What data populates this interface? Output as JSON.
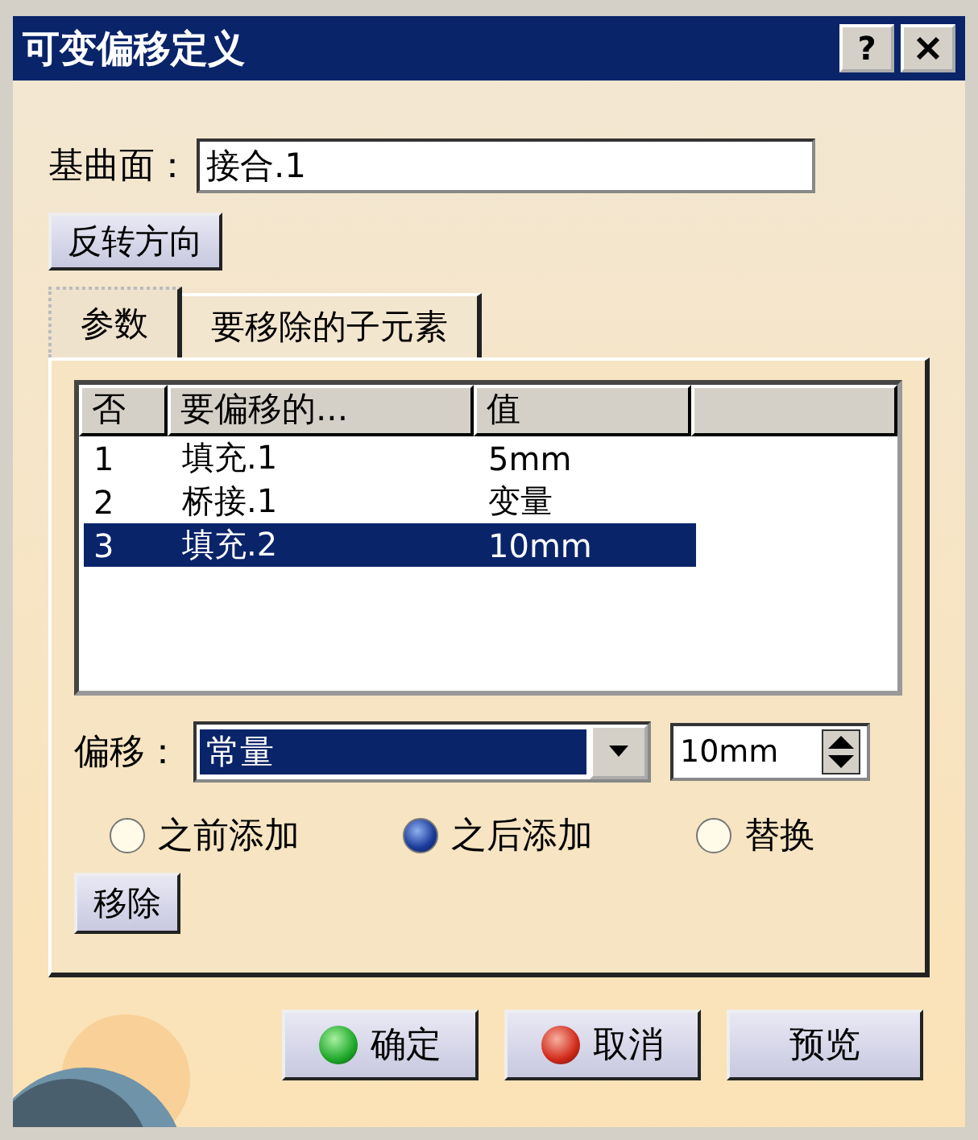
{
  "window": {
    "title": "可变偏移定义",
    "help": "?"
  },
  "base_surface": {
    "label": "基曲面：",
    "value": "接合.1"
  },
  "reverse_button": "反转方向",
  "tabs": [
    {
      "label": "参数",
      "selected": true
    },
    {
      "label": "要移除的子元素",
      "selected": false
    }
  ],
  "table": {
    "columns": [
      "否",
      "要偏移的...",
      "值"
    ],
    "rows": [
      {
        "cells": [
          "1",
          "填充.1",
          "5mm"
        ],
        "selected": false
      },
      {
        "cells": [
          "2",
          "桥接.1",
          "变量"
        ],
        "selected": false
      },
      {
        "cells": [
          "3",
          "填充.2",
          "10mm"
        ],
        "selected": true
      }
    ]
  },
  "offset": {
    "label": "偏移：",
    "value": "常量",
    "spin_value": "10mm"
  },
  "radios": [
    {
      "label": "之前添加",
      "selected": false
    },
    {
      "label": "之后添加",
      "selected": true
    },
    {
      "label": "替换",
      "selected": false
    }
  ],
  "remove_button": "移除",
  "buttons": [
    {
      "label": "确定",
      "kind": "ok"
    },
    {
      "label": "取消",
      "kind": "cancel"
    },
    {
      "label": "预览",
      "kind": "plain"
    }
  ]
}
